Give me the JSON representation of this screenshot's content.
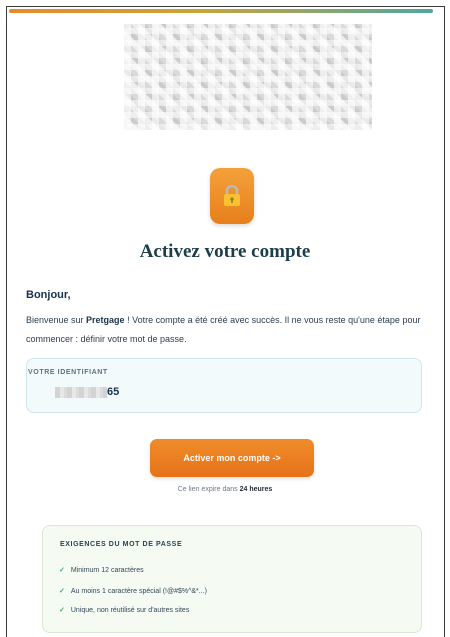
{
  "brand_logo": {
    "icon": "logo-blurred"
  },
  "hero": {
    "icon": "lock-icon",
    "title": "Activez votre compte"
  },
  "message": {
    "greeting": "Bonjour,",
    "intro_prefix": "Bienvenue sur ",
    "brand_name": "Pretgage",
    "intro_suffix": " ! Votre compte a été créé avec succès. Il ne vous reste qu'une étape pour commencer : définir votre mot de passe."
  },
  "identifier": {
    "label": "VOTRE IDENTIFIANT",
    "value_visible": "65"
  },
  "cta": {
    "label": "Activer mon compte ->"
  },
  "expiry": {
    "prefix": "Ce lien expire dans ",
    "duration": "24 heures"
  },
  "requirements": {
    "title": "EXIGENCES DU MOT DE PASSE",
    "items": [
      {
        "check": "✓",
        "text": "Minimum 12 caractères"
      },
      {
        "check": "✓",
        "text": "Au moins 1 caractère spécial (!@#$%^&*...)"
      },
      {
        "check": "✓",
        "text": "Unique, non réutilisé sur d'autres sites"
      }
    ]
  },
  "colors": {
    "accent_orange": "#e98a2a",
    "accent_teal": "#4fa7a0",
    "heading": "#1d3d4a"
  }
}
